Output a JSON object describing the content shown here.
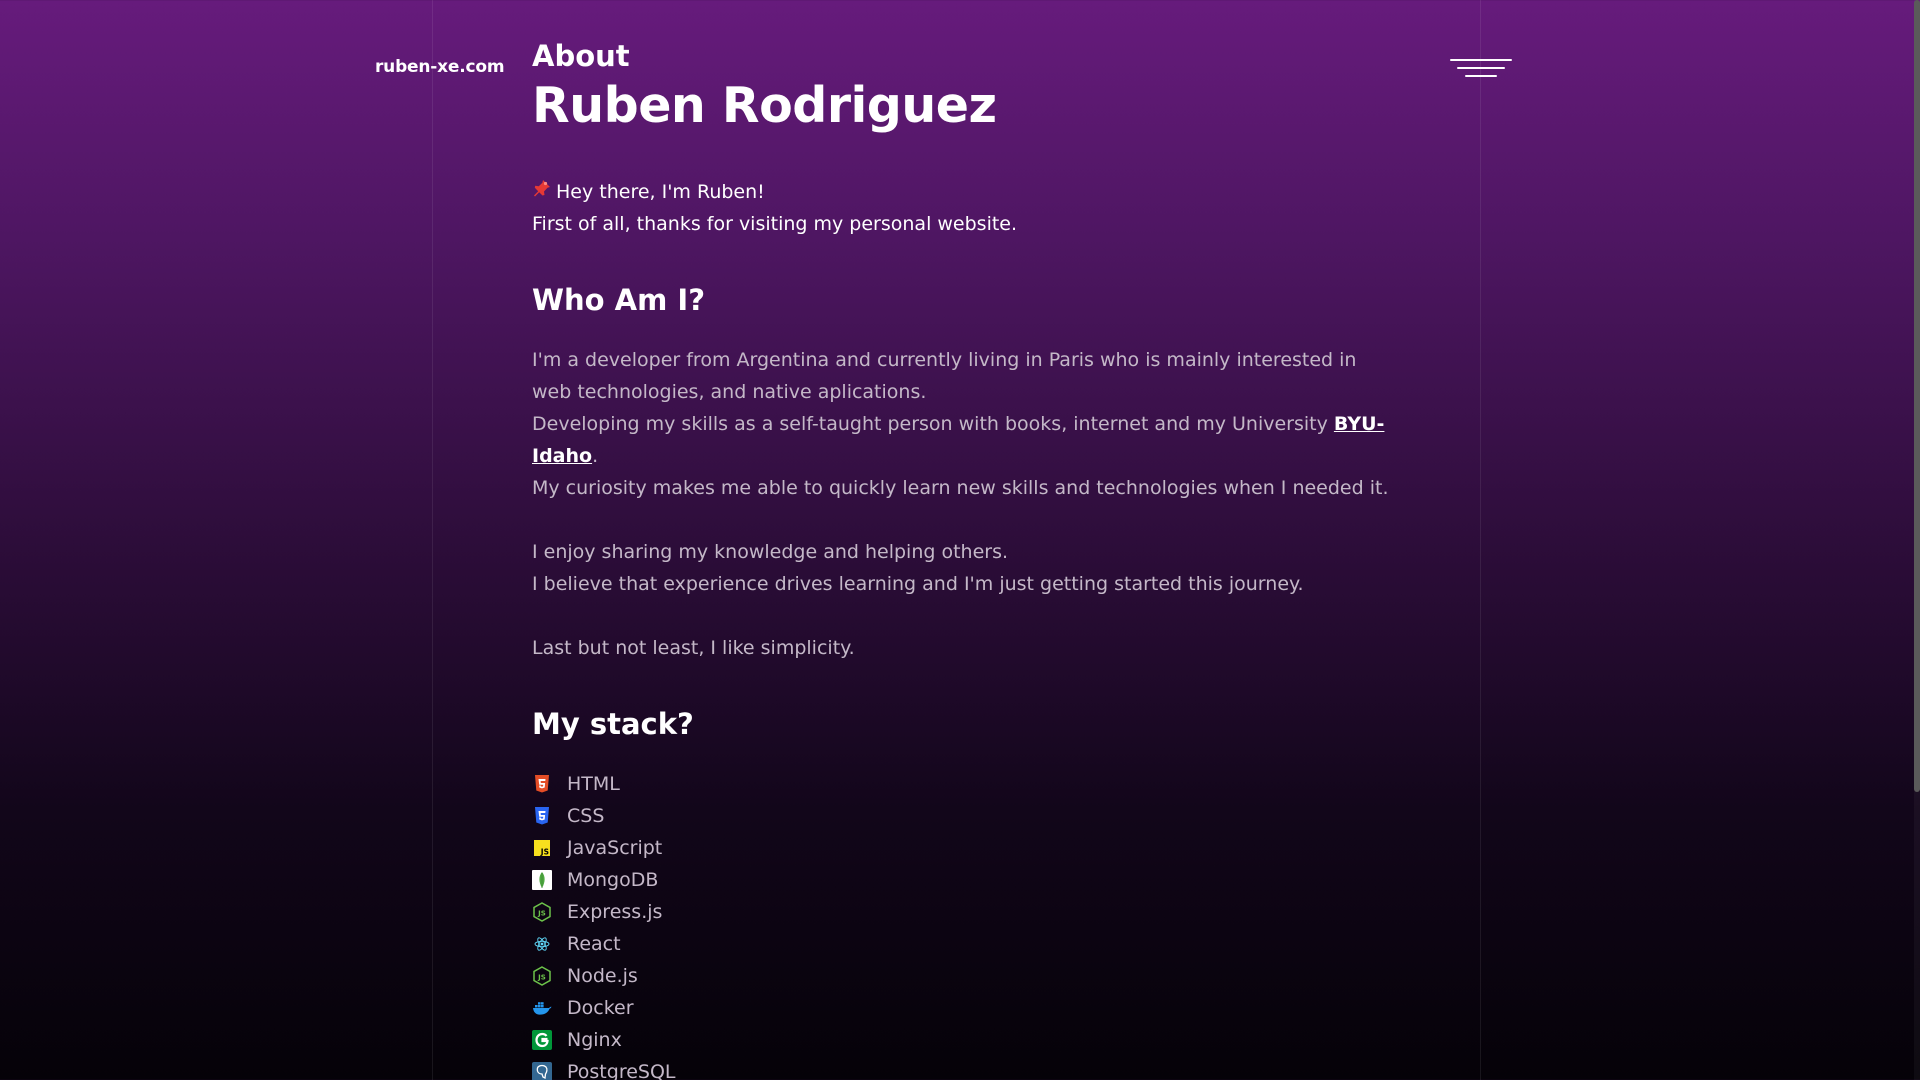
{
  "header": {
    "site_name": "ruben-xe.com"
  },
  "page": {
    "eyebrow": "About",
    "title": "Ruben Rodriguez"
  },
  "intro": {
    "greeting": "Hey there, I'm Ruben!",
    "thanks": "First of all, thanks for visiting my personal website."
  },
  "who_am_i": {
    "heading": "Who Am I?",
    "p1": "I'm a developer from Argentina and currently living in Paris who is mainly interested in web technologies, and native aplications.",
    "p2_before": "Developing my skills as a self-taught person with books, internet and my University ",
    "p2_link": "BYU-Idaho",
    "p2_after": ".",
    "p3": "My curiosity makes me able to quickly learn new skills and technologies when I needed it.",
    "p4": "I enjoy sharing my knowledge and helping others.",
    "p5": "I believe that experience drives learning and I'm just getting started this journey.",
    "p6": "Last but not least, I like simplicity."
  },
  "stack": {
    "heading": "My stack?",
    "items": [
      {
        "label": "HTML",
        "icon": "html5-icon",
        "color": "#e44d26"
      },
      {
        "label": "CSS",
        "icon": "css3-icon",
        "color": "#2965f1"
      },
      {
        "label": "JavaScript",
        "icon": "javascript-icon",
        "color": "#f7df1e"
      },
      {
        "label": "MongoDB",
        "icon": "mongodb-icon",
        "color": "#4faa41"
      },
      {
        "label": "Express.js",
        "icon": "nodejs-hex-icon",
        "color": "#6cc24a"
      },
      {
        "label": "React",
        "icon": "react-icon",
        "color": "#61dafb"
      },
      {
        "label": "Node.js",
        "icon": "nodejs-hex-icon",
        "color": "#6cc24a"
      },
      {
        "label": "Docker",
        "icon": "docker-icon",
        "color": "#2496ed"
      },
      {
        "label": "Nginx",
        "icon": "nginx-icon",
        "color": "#009639"
      },
      {
        "label": "PostgreSQL",
        "icon": "postgresql-icon",
        "color": "#336791"
      }
    ]
  }
}
